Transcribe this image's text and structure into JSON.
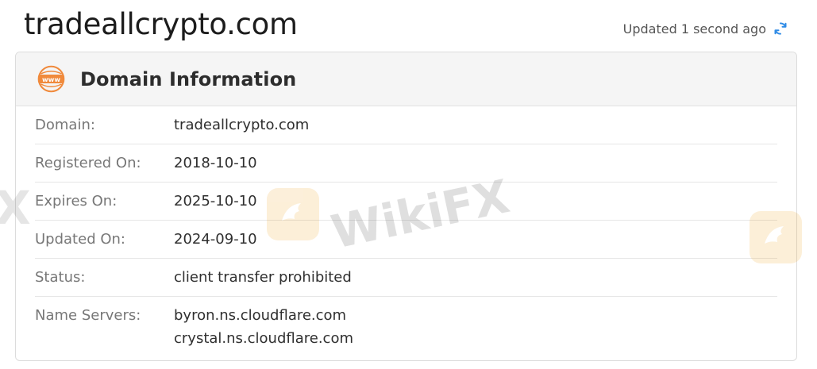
{
  "page": {
    "title": "tradeallcrypto.com",
    "updated_text": "Updated 1 second ago"
  },
  "card": {
    "title": "Domain Information",
    "icon_text": "www",
    "rows": [
      {
        "label": "Domain:",
        "values": [
          "tradeallcrypto.com"
        ]
      },
      {
        "label": "Registered On:",
        "values": [
          "2018-10-10"
        ]
      },
      {
        "label": "Expires On:",
        "values": [
          "2025-10-10"
        ]
      },
      {
        "label": "Updated On:",
        "values": [
          "2024-09-10"
        ]
      },
      {
        "label": "Status:",
        "values": [
          "client transfer prohibited"
        ]
      },
      {
        "label": "Name Servers:",
        "values": [
          "byron.ns.cloudflare.com",
          "crystal.ns.cloudflare.com"
        ]
      }
    ]
  },
  "watermark": {
    "text": "WikiFX",
    "partial": "X"
  },
  "colors": {
    "accent_orange": "#f08a3c",
    "refresh_blue": "#2f8be6"
  }
}
